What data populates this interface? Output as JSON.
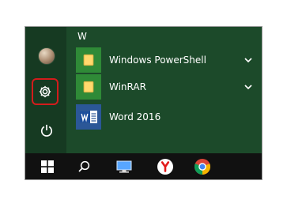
{
  "start_menu": {
    "section_letter": "W",
    "apps": [
      {
        "label": "Windows PowerShell",
        "icon": "folder-icon",
        "expandable": true
      },
      {
        "label": "WinRAR",
        "icon": "folder-icon",
        "expandable": true
      },
      {
        "label": "Word 2016",
        "icon": "word-icon",
        "expandable": false
      }
    ],
    "rail": {
      "avatar": "user-avatar",
      "settings": "gear-icon",
      "power": "power-icon"
    }
  },
  "taskbar": {
    "items": [
      "windows-logo-icon",
      "search-icon",
      "desktop-icon",
      "yandex-browser-icon",
      "chrome-icon"
    ]
  },
  "colors": {
    "panel": "#1c4a2a",
    "rail": "#163a22",
    "taskbar": "#111111",
    "highlight": "#d31c1c",
    "tile_green": "#2f8a37",
    "tile_blue": "#2b5797"
  }
}
